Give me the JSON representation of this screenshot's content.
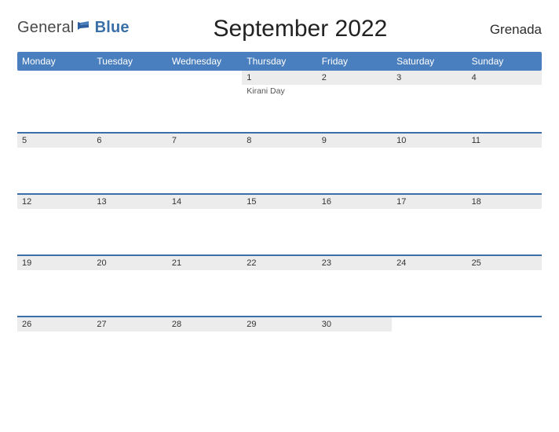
{
  "brand": {
    "left": "General",
    "right": "Blue"
  },
  "title": "September 2022",
  "country": "Grenada",
  "day_names": [
    "Monday",
    "Tuesday",
    "Wednesday",
    "Thursday",
    "Friday",
    "Saturday",
    "Sunday"
  ],
  "weeks": [
    [
      {
        "date": "",
        "events": []
      },
      {
        "date": "",
        "events": []
      },
      {
        "date": "",
        "events": []
      },
      {
        "date": "1",
        "events": [
          "Kirani Day"
        ]
      },
      {
        "date": "2",
        "events": []
      },
      {
        "date": "3",
        "events": []
      },
      {
        "date": "4",
        "events": []
      }
    ],
    [
      {
        "date": "5",
        "events": []
      },
      {
        "date": "6",
        "events": []
      },
      {
        "date": "7",
        "events": []
      },
      {
        "date": "8",
        "events": []
      },
      {
        "date": "9",
        "events": []
      },
      {
        "date": "10",
        "events": []
      },
      {
        "date": "11",
        "events": []
      }
    ],
    [
      {
        "date": "12",
        "events": []
      },
      {
        "date": "13",
        "events": []
      },
      {
        "date": "14",
        "events": []
      },
      {
        "date": "15",
        "events": []
      },
      {
        "date": "16",
        "events": []
      },
      {
        "date": "17",
        "events": []
      },
      {
        "date": "18",
        "events": []
      }
    ],
    [
      {
        "date": "19",
        "events": []
      },
      {
        "date": "20",
        "events": []
      },
      {
        "date": "21",
        "events": []
      },
      {
        "date": "22",
        "events": []
      },
      {
        "date": "23",
        "events": []
      },
      {
        "date": "24",
        "events": []
      },
      {
        "date": "25",
        "events": []
      }
    ],
    [
      {
        "date": "26",
        "events": []
      },
      {
        "date": "27",
        "events": []
      },
      {
        "date": "28",
        "events": []
      },
      {
        "date": "29",
        "events": []
      },
      {
        "date": "30",
        "events": []
      },
      {
        "date": "",
        "events": []
      },
      {
        "date": "",
        "events": []
      }
    ]
  ]
}
